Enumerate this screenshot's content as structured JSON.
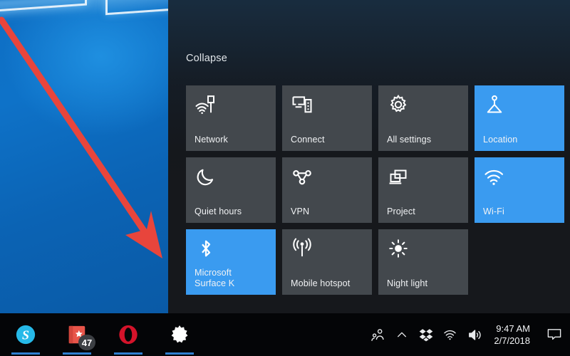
{
  "desktop": {
    "wallpaper_name": "windows-10-hero-wallpaper",
    "accent_blue": "#0e72c8"
  },
  "annotation": {
    "arrow_color": "#e8453c",
    "arrow_name": "red-pointer-arrow",
    "points_to": "Microsoft Surface K"
  },
  "action_center": {
    "collapse_label": "Collapse",
    "accent_color": "#3a9bf0",
    "tile_color": "#43484d",
    "rows": [
      [
        {
          "label": "Network",
          "icon": "network-icon",
          "state": "off"
        },
        {
          "label": "Connect",
          "icon": "connect-icon",
          "state": "off"
        },
        {
          "label": "All settings",
          "icon": "gear-icon",
          "state": "off"
        },
        {
          "label": "Location",
          "icon": "location-icon",
          "state": "on"
        }
      ],
      [
        {
          "label": "Quiet hours",
          "icon": "moon-icon",
          "state": "off"
        },
        {
          "label": "VPN",
          "icon": "vpn-icon",
          "state": "off"
        },
        {
          "label": "Project",
          "icon": "project-icon",
          "state": "off"
        },
        {
          "label": "Wi-Fi",
          "icon": "wifi-icon",
          "state": "on"
        }
      ],
      [
        {
          "label": "Microsoft\nSurface K",
          "icon": "bluetooth-icon",
          "state": "on"
        },
        {
          "label": "Mobile hotspot",
          "icon": "hotspot-icon",
          "state": "off"
        },
        {
          "label": "Night light",
          "icon": "night-light-icon",
          "state": "off"
        },
        {
          "label": "",
          "icon": "",
          "state": "empty"
        }
      ]
    ]
  },
  "taskbar": {
    "apps": [
      {
        "name": "skype",
        "label": "Skype",
        "running": true,
        "badge": ""
      },
      {
        "name": "store",
        "label": "Store",
        "running": true,
        "badge": "47"
      },
      {
        "name": "opera",
        "label": "Opera",
        "running": true,
        "badge": ""
      },
      {
        "name": "settings",
        "label": "Settings",
        "running": true,
        "badge": ""
      }
    ],
    "tray": [
      {
        "name": "people-icon",
        "label": "People"
      },
      {
        "name": "chevron-up-icon",
        "label": "Show hidden icons"
      },
      {
        "name": "dropbox-icon",
        "label": "Dropbox"
      },
      {
        "name": "wifi-icon",
        "label": "Network"
      },
      {
        "name": "volume-icon",
        "label": "Volume"
      }
    ],
    "clock": {
      "time": "9:47 AM",
      "date": "2/7/2018"
    },
    "action_center_icon": "action-center-icon"
  }
}
